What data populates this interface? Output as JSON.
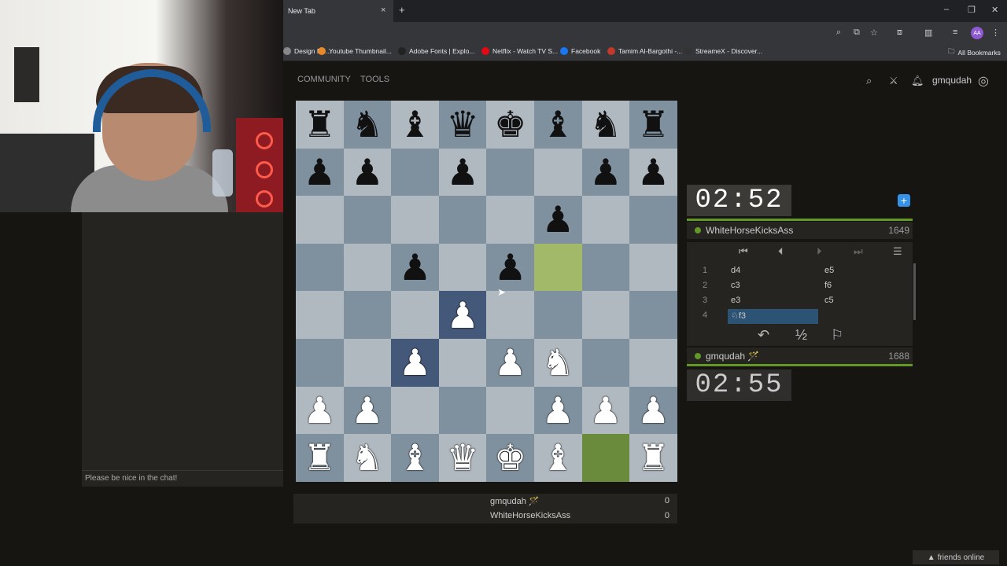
{
  "browser": {
    "tab_title": "New Tab",
    "tab_close": "×",
    "new_tab": "+",
    "minimize": "–",
    "restore": "❐",
    "close": "✕",
    "profile": "AA",
    "bookmarks": [
      {
        "label": "Design Re...",
        "color": "#888"
      },
      {
        "label": "Youtube Thumbnail...",
        "color": "#e88a2a"
      },
      {
        "label": "Adobe Fonts | Explo...",
        "color": "#222"
      },
      {
        "label": "Netflix - Watch TV S...",
        "color": "#e50914"
      },
      {
        "label": "Facebook",
        "color": "#1877f2"
      },
      {
        "label": "Tamim Al-Bargothi -...",
        "color": "#c0392b"
      },
      {
        "label": "StreameX - Discover...",
        "color": "#333"
      }
    ],
    "all_bookmarks": "All Bookmarks"
  },
  "site": {
    "nav": [
      "COMMUNITY",
      "TOOLS"
    ],
    "username": "gmqudah"
  },
  "board": {
    "rows": [
      [
        "r",
        "n",
        "b",
        "q",
        "k",
        "b",
        "n",
        "r"
      ],
      [
        "p",
        "p",
        "",
        "p",
        "",
        "",
        "p",
        "p"
      ],
      [
        "",
        "",
        "",
        "",
        "",
        "p",
        "",
        ""
      ],
      [
        "",
        "",
        "p",
        "",
        "p",
        "",
        "",
        ""
      ],
      [
        "",
        "",
        "",
        "P",
        "",
        "",
        "",
        ""
      ],
      [
        "",
        "",
        "P",
        "",
        "P",
        "N",
        "",
        ""
      ],
      [
        "P",
        "P",
        "",
        "",
        "",
        "P",
        "P",
        "P"
      ],
      [
        "R",
        "N",
        "B",
        "Q",
        "K",
        "B",
        "",
        "R"
      ]
    ],
    "highlights": {
      "3-5": "hl3",
      "7-6": "hl",
      "4-3": "hl2",
      "5-2": "hl2"
    }
  },
  "game": {
    "top_clock": "02:52",
    "bottom_clock": "02:55",
    "top_player": "WhiteHorseKicksAss",
    "top_rating": "1649",
    "bottom_player": "gmqudah 🪄",
    "bottom_rating": "1688",
    "moves": [
      {
        "n": "1",
        "w": "d4",
        "b": "e5"
      },
      {
        "n": "2",
        "w": "c3",
        "b": "f6"
      },
      {
        "n": "3",
        "w": "e3",
        "b": "c5"
      },
      {
        "n": "4",
        "w": "♘f3",
        "b": ""
      }
    ],
    "draw_label": "½"
  },
  "score": {
    "rows": [
      {
        "name": "gmqudah 🪄",
        "value": "0"
      },
      {
        "name": "WhiteHorseKicksAss",
        "value": "0"
      }
    ]
  },
  "chat": {
    "placeholder": "Please be nice in the chat!"
  },
  "footer": {
    "friends": "friends online"
  }
}
